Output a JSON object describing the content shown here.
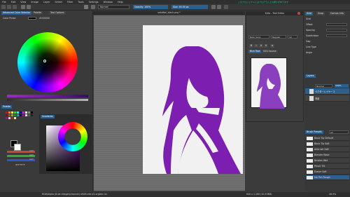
{
  "menu": [
    "File",
    "Edit",
    "View",
    "Image",
    "Layer",
    "Select",
    "Filter",
    "Tools",
    "Settings",
    "Window",
    "Help"
  ],
  "tool_options": {
    "blend_mode": "Normal",
    "opacity_label": "Opacity: 100%",
    "size_label": "Size: 40.00 px"
  },
  "document_title": "sekaikei_black.png *",
  "top_right_info": "このプロジェクトにはプログラム上の誤りがあります",
  "left_panel": {
    "tabs": [
      "Advanced Color Selector",
      "Palette",
      "Tool Options"
    ],
    "color_label": "Color Picker",
    "color_value": "#000000",
    "palette_label": "Palette",
    "gradient_label": "Gradients"
  },
  "color_values": {
    "r": "127",
    "g": "127",
    "b": "127",
    "hex": "#7F7F7F"
  },
  "dialog": {
    "title": "Krita - Text Editor",
    "font": "Noto Sans",
    "style": "Regular",
    "size": "12",
    "rich_text_tab": "Rich Text",
    "svg_tab": "SVG Source",
    "bold": "B",
    "italic": "I",
    "underline": "U",
    "strike": "S",
    "align_left": "≡"
  },
  "right_panel": {
    "tabs": [
      "Grid",
      "Snap",
      "Canvas Info"
    ],
    "fields": [
      "Grid",
      "Offset",
      "Spacing",
      "Subdivision",
      "Gap",
      "Line Type",
      "Angle"
    ],
    "layers_label": "Layers",
    "blend_mode": "Normal",
    "opacity": "100%",
    "layers": [
      "ベクターレイヤー 2",
      "背景"
    ],
    "brushes_label": "Brush Presets",
    "brush_tag": "All",
    "brushes": [
      "Basic Tip Default",
      "Basic Tip Soft",
      "Airbrush Soft",
      "Blender Basic",
      "Bristles Wet",
      "Pencil Tilt",
      "Eraser Soft",
      "Ink Pen Rough"
    ]
  },
  "status": {
    "left": "RGB/Alpha (8-bit integer/channel) sRGB-elle-V2-srgbtrc.icc",
    "right": "640 x 1,280 (10.9 MiB)",
    "zoom": "26.9%"
  },
  "colors": {
    "accent": "#2d5f8d",
    "character": "#7c1fb0",
    "page": "#f1f1f1"
  }
}
